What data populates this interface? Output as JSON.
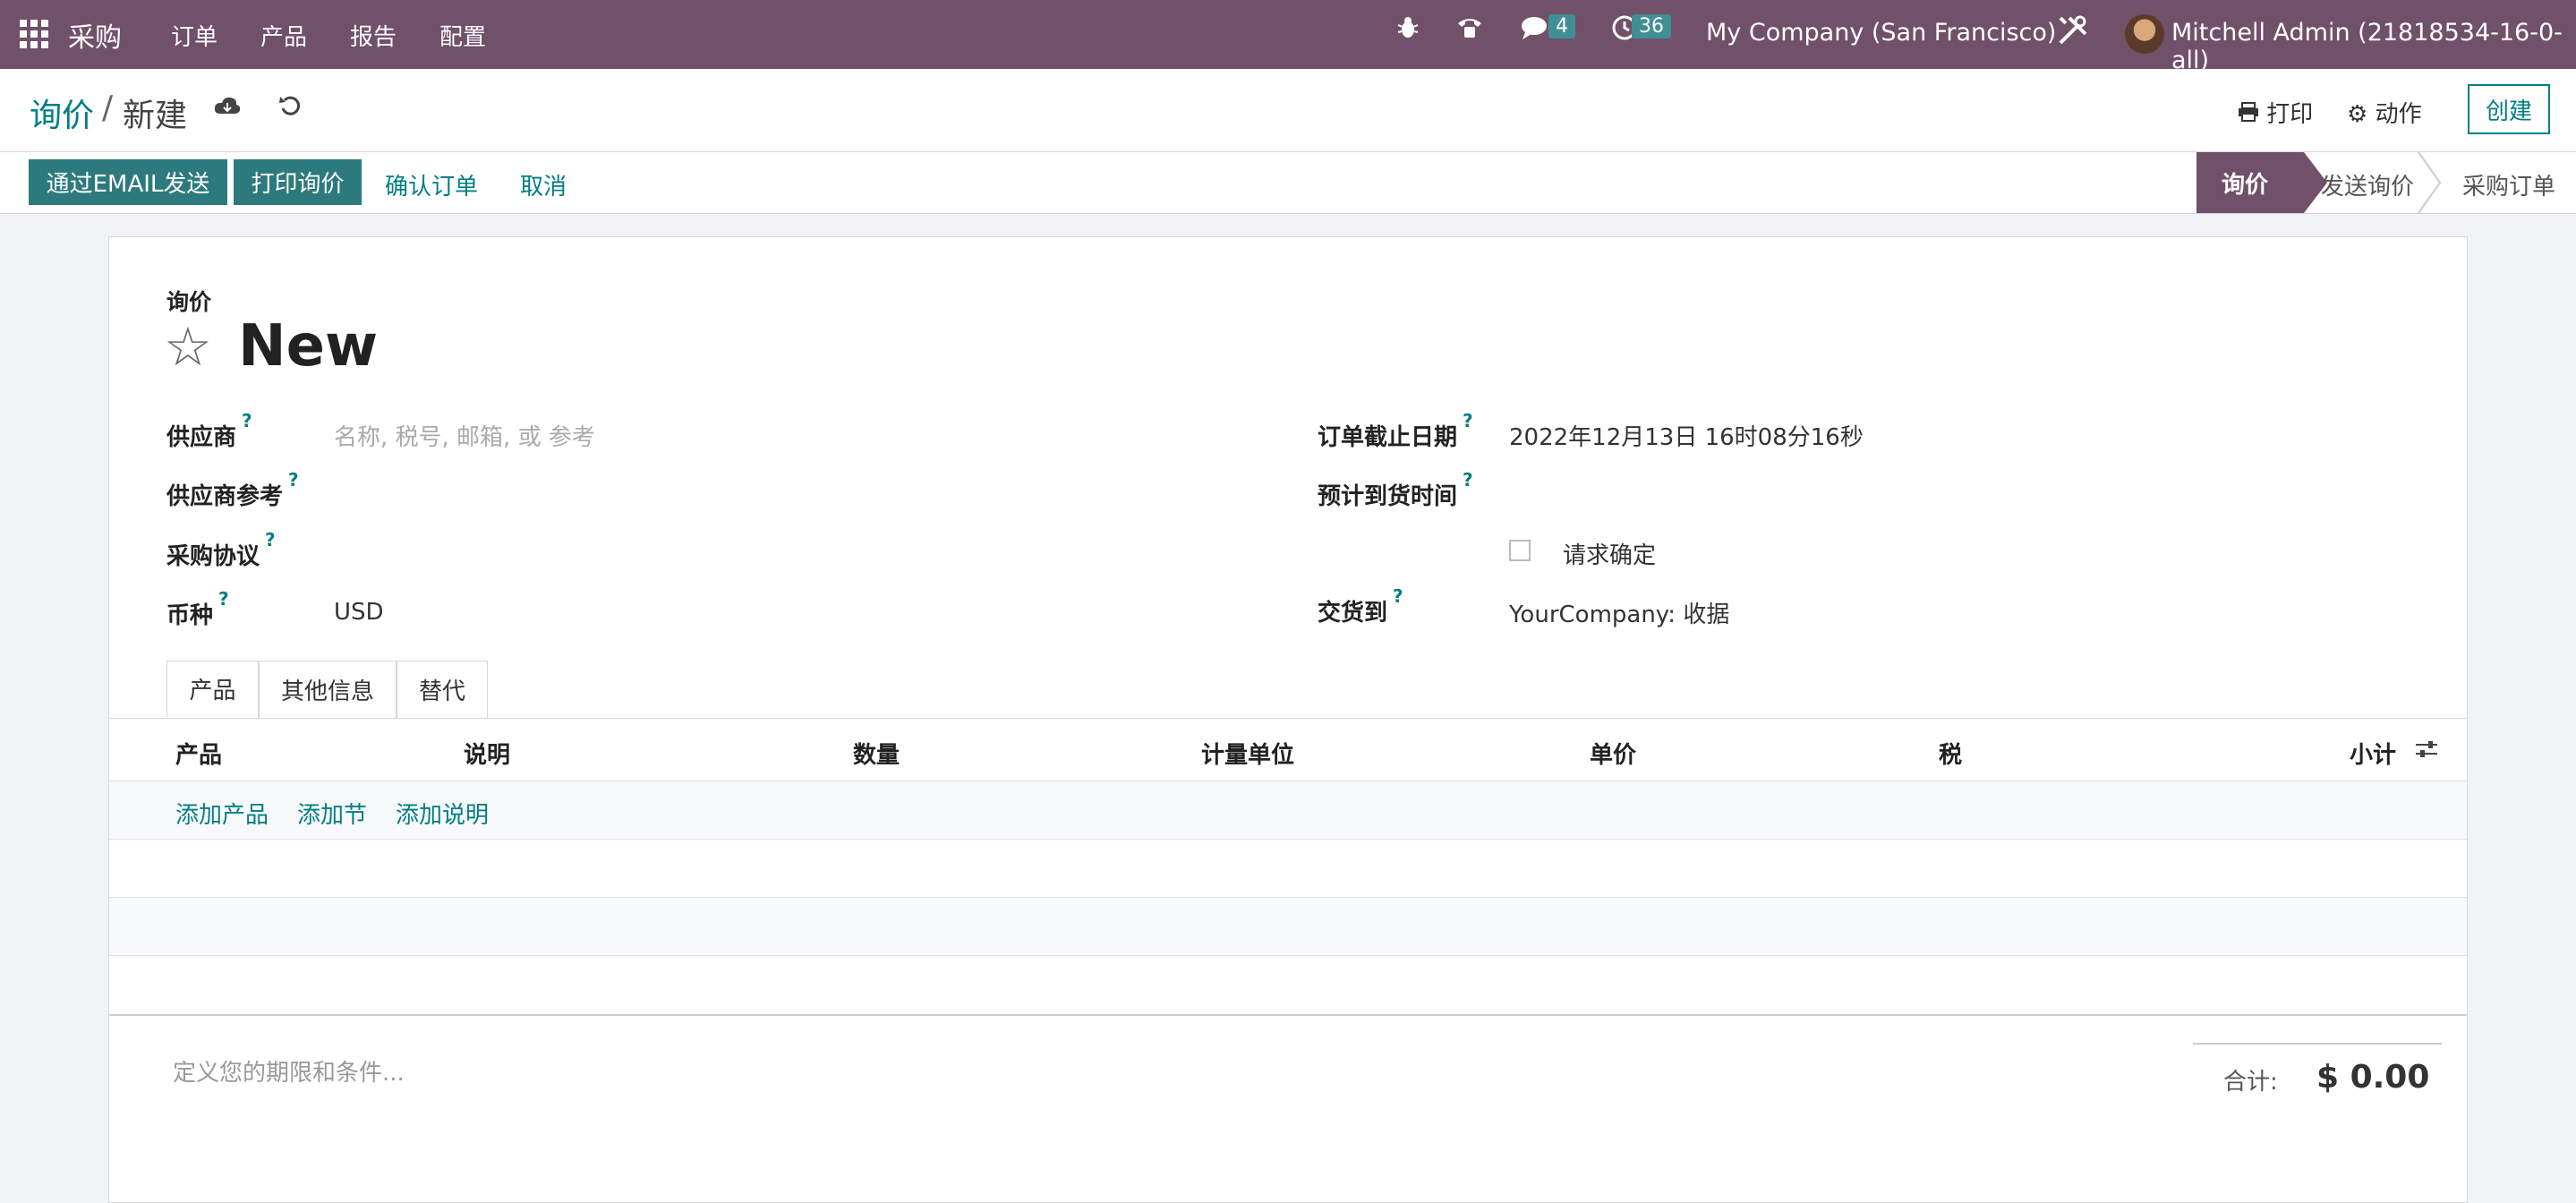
{
  "navbar": {
    "app_name": "采购",
    "menu": [
      "订单",
      "产品",
      "报告",
      "配置"
    ],
    "messages_count": "4",
    "activities_count": "36",
    "company": "My Company (San Francisco)",
    "user": "Mitchell Admin (21818534-16-0-all)"
  },
  "breadcrumb": {
    "parent": "询价",
    "separator": "/",
    "current": "新建"
  },
  "control": {
    "print": "打印",
    "action": "动作",
    "create": "创建"
  },
  "statusbar": {
    "buttons": [
      "通过EMAIL发送",
      "打印询价"
    ],
    "links": [
      "确认订单",
      "取消"
    ],
    "stages": [
      "询价",
      "发送询价",
      "采购订单"
    ],
    "active_stage": "询价"
  },
  "form": {
    "doc_type": "询价",
    "name": "New",
    "vendor_label": "供应商",
    "vendor_placeholder": "名称, 税号, 邮箱, 或 参考",
    "vendor_ref_label": "供应商参考",
    "agreement_label": "采购协议",
    "currency_label": "币种",
    "currency_value": "USD",
    "deadline_label": "订单截止日期",
    "deadline_value": "2022年12月13日 16时08分16秒",
    "expected_label": "预计到货时间",
    "confirm_label": "请求确定",
    "deliver_label": "交货到",
    "deliver_value": "YourCompany: 收据",
    "help_mark": "?"
  },
  "tabs": [
    "产品",
    "其他信息",
    "替代"
  ],
  "table": {
    "headers": [
      "产品",
      "说明",
      "数量",
      "计量单位",
      "单价",
      "税",
      "小计"
    ],
    "add_links": [
      "添加产品",
      "添加节",
      "添加说明"
    ]
  },
  "footer": {
    "terms_placeholder": "定义您的期限和条件...",
    "total_label": "合计:",
    "total_value": "$ 0.00"
  },
  "colors": {
    "brand": "#71506a",
    "accent": "#017e84",
    "button": "#2d7a7e"
  }
}
